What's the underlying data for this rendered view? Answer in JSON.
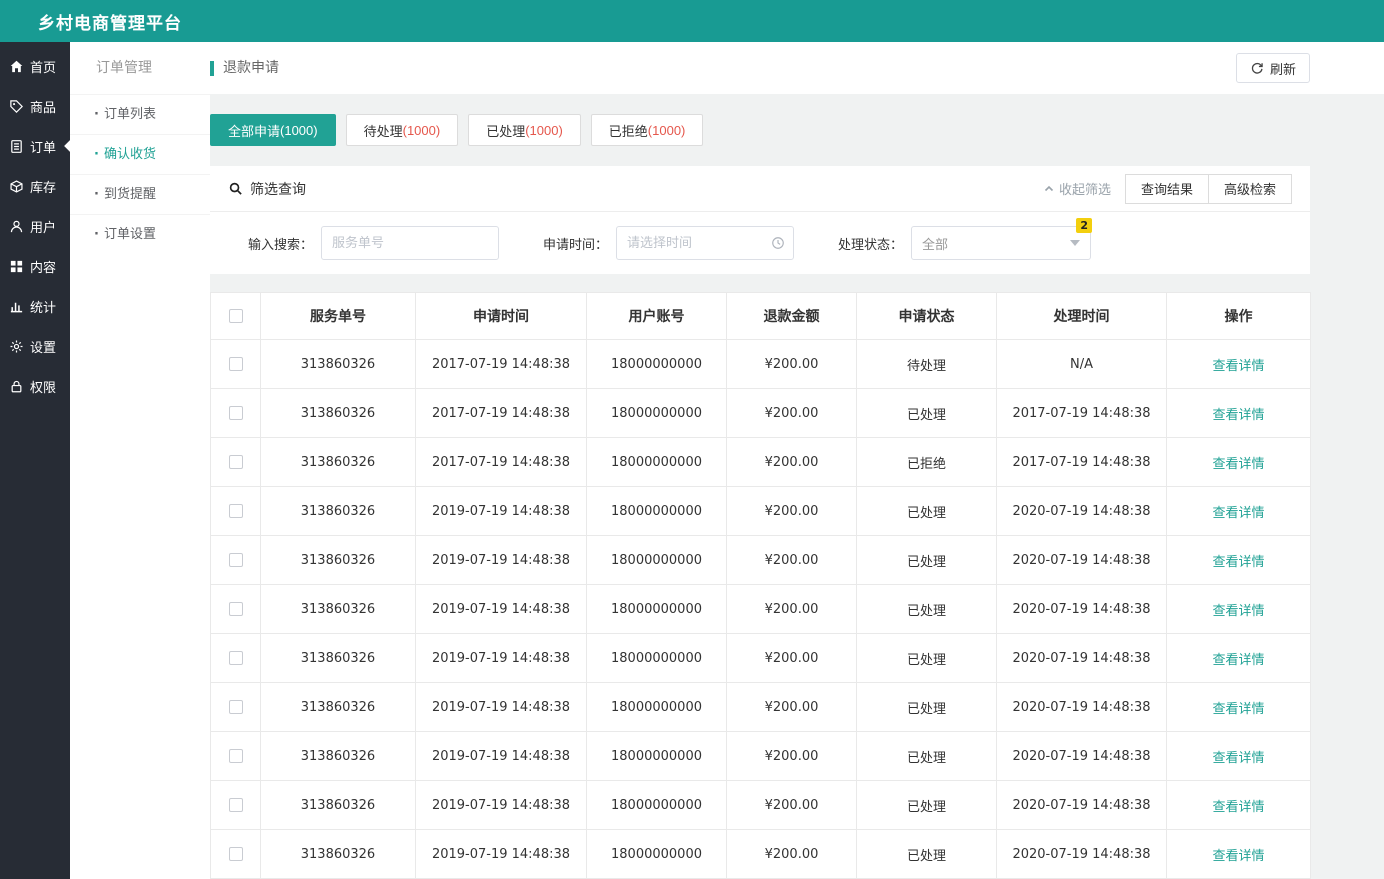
{
  "colors": {
    "header_bg": "#189B93",
    "sidebar_bg": "#272C35",
    "accent": "#21A295",
    "count_red": "#E5574C",
    "badge_yellow": "#F3CF0E"
  },
  "app": {
    "title": "乡村电商管理平台"
  },
  "sidebar": {
    "items": [
      {
        "id": "home",
        "label": "首页",
        "icon": "home-icon",
        "active": false
      },
      {
        "id": "goods",
        "label": "商品",
        "icon": "goods-icon",
        "active": false
      },
      {
        "id": "orders",
        "label": "订单",
        "icon": "orders-icon",
        "active": true
      },
      {
        "id": "inventory",
        "label": "库存",
        "icon": "inventory-icon",
        "active": false
      },
      {
        "id": "users",
        "label": "用户",
        "icon": "users-icon",
        "active": false
      },
      {
        "id": "content",
        "label": "内容",
        "icon": "content-icon",
        "active": false
      },
      {
        "id": "stats",
        "label": "统计",
        "icon": "stats-icon",
        "active": false
      },
      {
        "id": "settings",
        "label": "设置",
        "icon": "gear-icon",
        "active": false
      },
      {
        "id": "permissions",
        "label": "权限",
        "icon": "lock-icon",
        "active": false
      }
    ]
  },
  "submenu": {
    "title": "订单管理",
    "items": [
      {
        "id": "order-list",
        "label": "订单列表",
        "active": false
      },
      {
        "id": "confirm-receipt",
        "label": "确认收货",
        "active": true
      },
      {
        "id": "arrival-reminder",
        "label": "到货提醒",
        "active": false
      },
      {
        "id": "order-settings",
        "label": "订单设置",
        "active": false
      }
    ]
  },
  "page": {
    "title": "退款申请",
    "refresh_label": "刷新"
  },
  "tabs": [
    {
      "id": "all",
      "label": "全部申请",
      "count": "(1000)",
      "active": true
    },
    {
      "id": "pending",
      "label": "待处理",
      "count": "(1000)",
      "active": false
    },
    {
      "id": "processed",
      "label": "已处理",
      "count": "(1000)",
      "active": false
    },
    {
      "id": "rejected",
      "label": "已拒绝",
      "count": "(1000)",
      "active": false
    }
  ],
  "filter": {
    "title": "筛选查询",
    "collapse_label": "收起筛选",
    "result_button": "查询结果",
    "advanced_button": "高级检索",
    "search_label": "输入搜索：",
    "search_placeholder": "服务单号",
    "time_label": "申请时间：",
    "time_placeholder": "请选择时间",
    "status_label": "处理状态：",
    "status_value": "全部",
    "badge": "2"
  },
  "table": {
    "columns": [
      "服务单号",
      "申请时间",
      "用户账号",
      "退款金额",
      "申请状态",
      "处理时间",
      "操作"
    ],
    "action_label": "查看详情",
    "rows": [
      {
        "service_no": "313860326",
        "apply_time": "2017-07-19 14:48:38",
        "account": "18000000000",
        "amount": "¥200.00",
        "status": "待处理",
        "handle_time": "N/A"
      },
      {
        "service_no": "313860326",
        "apply_time": "2017-07-19 14:48:38",
        "account": "18000000000",
        "amount": "¥200.00",
        "status": "已处理",
        "handle_time": "2017-07-19 14:48:38"
      },
      {
        "service_no": "313860326",
        "apply_time": "2017-07-19 14:48:38",
        "account": "18000000000",
        "amount": "¥200.00",
        "status": "已拒绝",
        "handle_time": "2017-07-19 14:48:38"
      },
      {
        "service_no": "313860326",
        "apply_time": "2019-07-19 14:48:38",
        "account": "18000000000",
        "amount": "¥200.00",
        "status": "已处理",
        "handle_time": "2020-07-19 14:48:38"
      },
      {
        "service_no": "313860326",
        "apply_time": "2019-07-19 14:48:38",
        "account": "18000000000",
        "amount": "¥200.00",
        "status": "已处理",
        "handle_time": "2020-07-19 14:48:38"
      },
      {
        "service_no": "313860326",
        "apply_time": "2019-07-19 14:48:38",
        "account": "18000000000",
        "amount": "¥200.00",
        "status": "已处理",
        "handle_time": "2020-07-19 14:48:38"
      },
      {
        "service_no": "313860326",
        "apply_time": "2019-07-19 14:48:38",
        "account": "18000000000",
        "amount": "¥200.00",
        "status": "已处理",
        "handle_time": "2020-07-19 14:48:38"
      },
      {
        "service_no": "313860326",
        "apply_time": "2019-07-19 14:48:38",
        "account": "18000000000",
        "amount": "¥200.00",
        "status": "已处理",
        "handle_time": "2020-07-19 14:48:38"
      },
      {
        "service_no": "313860326",
        "apply_time": "2019-07-19 14:48:38",
        "account": "18000000000",
        "amount": "¥200.00",
        "status": "已处理",
        "handle_time": "2020-07-19 14:48:38"
      },
      {
        "service_no": "313860326",
        "apply_time": "2019-07-19 14:48:38",
        "account": "18000000000",
        "amount": "¥200.00",
        "status": "已处理",
        "handle_time": "2020-07-19 14:48:38"
      },
      {
        "service_no": "313860326",
        "apply_time": "2019-07-19 14:48:38",
        "account": "18000000000",
        "amount": "¥200.00",
        "status": "已处理",
        "handle_time": "2020-07-19 14:48:38"
      }
    ]
  }
}
